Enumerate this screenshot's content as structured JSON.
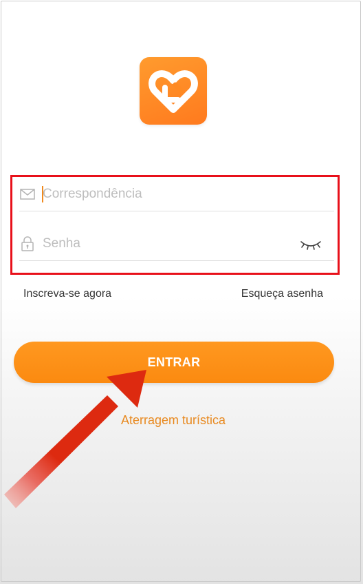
{
  "app": {
    "logo_icon": "heart-logo-icon",
    "accent_color": "#fd8d16"
  },
  "login_form": {
    "email_placeholder": "Correspondência",
    "email_value": "",
    "email_icon": "mail-icon",
    "password_placeholder": "Senha",
    "password_value": "",
    "password_icon": "lock-icon",
    "visibility_icon": "eye-closed-icon"
  },
  "links": {
    "register": "Inscreva-se agora",
    "forgot_password": "Esqueça asenha"
  },
  "actions": {
    "enter_label": "ENTRAR",
    "tourist_login": "Aterragem turística"
  },
  "annotations": {
    "highlight_color": "#e8101a",
    "arrow_color": "#dd2a10",
    "arrow_target": "ENTRAR"
  }
}
